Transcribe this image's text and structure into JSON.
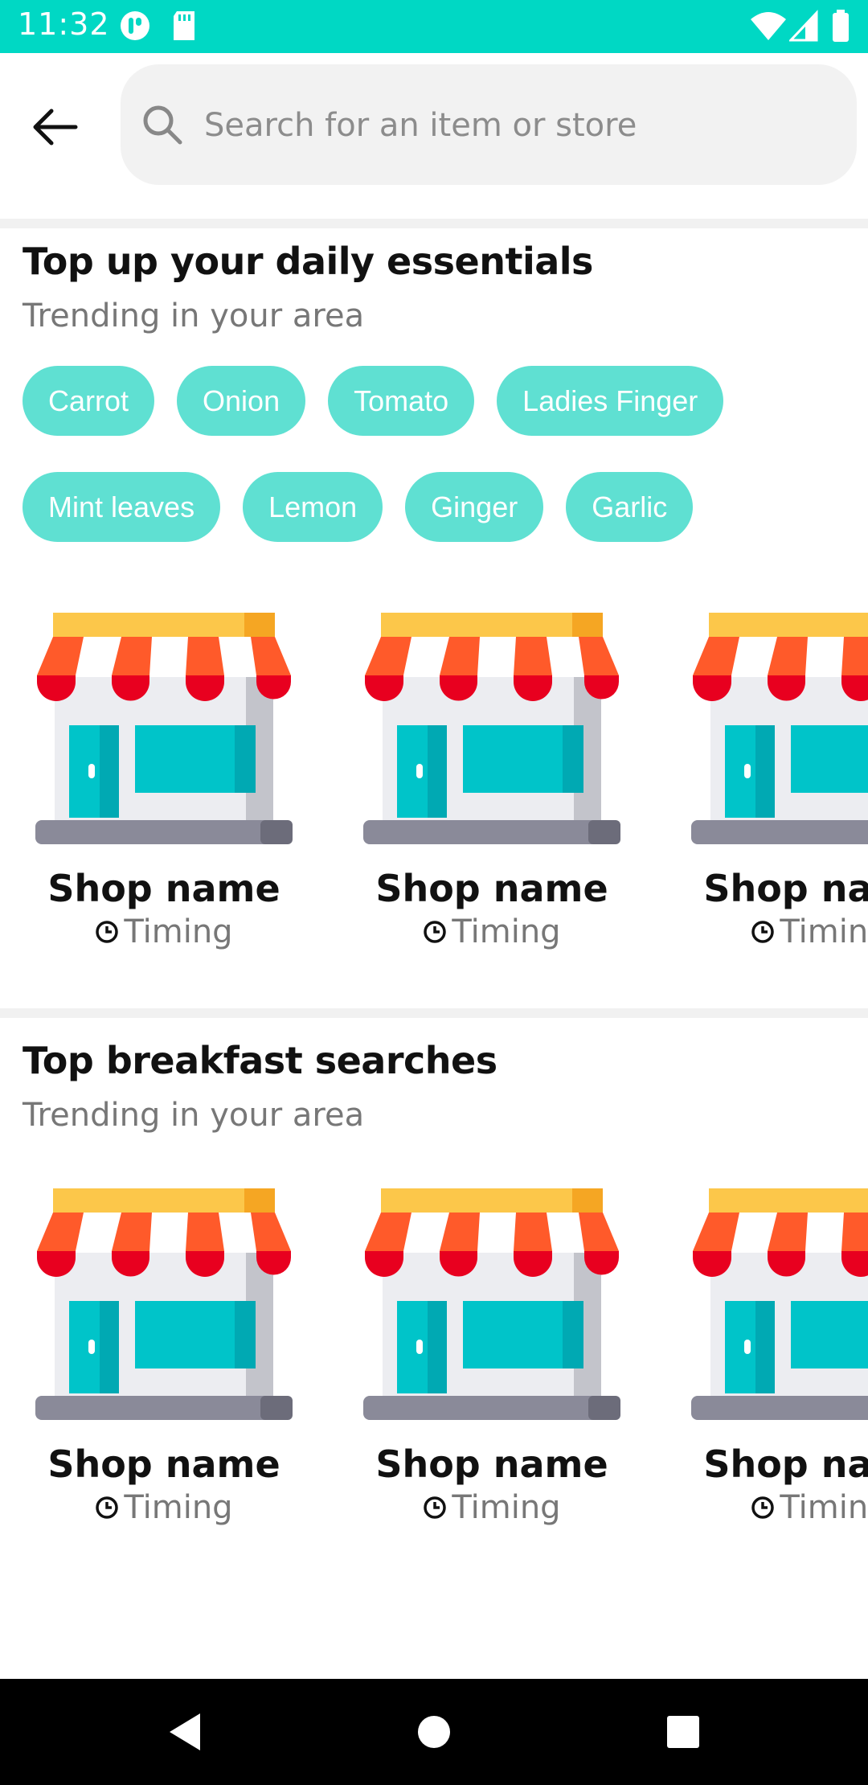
{
  "status_bar": {
    "time": "11:32",
    "icons": [
      "app-icon",
      "sd-card-icon",
      "wifi-icon",
      "signal-icon",
      "battery-icon"
    ]
  },
  "search": {
    "placeholder": "Search for an item or store"
  },
  "section1": {
    "title": "Top up your daily essentials",
    "subtitle": "Trending in your area",
    "chips_row1": [
      "Carrot",
      "Onion",
      "Tomato",
      "Ladies Finger"
    ],
    "chips_row2": [
      "Mint leaves",
      "Lemon",
      "Ginger",
      "Garlic"
    ],
    "shops": [
      {
        "name": "Shop name",
        "timing": "Timing"
      },
      {
        "name": "Shop name",
        "timing": "Timing"
      },
      {
        "name": "Shop name",
        "timing": "Timing"
      }
    ]
  },
  "section2": {
    "title": "Top breakfast searches",
    "subtitle": "Trending in your area",
    "shops": [
      {
        "name": "Shop name",
        "timing": "Timing"
      },
      {
        "name": "Shop name",
        "timing": "Timing"
      },
      {
        "name": "Shop name",
        "timing": "Timing"
      }
    ]
  },
  "colors": {
    "status_bar": "#00d8c4",
    "chip": "#5fe0d2",
    "awning_red": "#e8001f",
    "awning_orange": "#ff5a2a",
    "awning_top": "#fcc74a",
    "window_teal": "#00c4c9"
  },
  "nav_bar": {
    "icons": [
      "back-nav-icon",
      "home-nav-icon",
      "recents-nav-icon"
    ]
  }
}
